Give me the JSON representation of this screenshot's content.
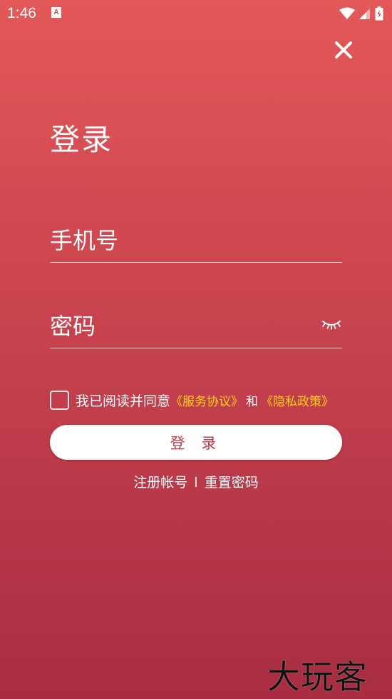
{
  "status_bar": {
    "time": "1:46",
    "app_icon_letter": "A"
  },
  "page": {
    "title": "登录"
  },
  "form": {
    "phone_placeholder": "手机号",
    "password_placeholder": "密码"
  },
  "agreement": {
    "prefix": "我已阅读并同意",
    "service_link": "《服务协议》",
    "and_text": "和",
    "privacy_link": "《隐私政策》"
  },
  "login_button_label": "登 录",
  "links": {
    "register": "注册帐号",
    "reset_password": "重置密码"
  },
  "watermark": "大玩客",
  "colors": {
    "gradient_top": "#e35858",
    "gradient_bottom": "#a82d42",
    "link_yellow": "#ffd21a",
    "button_text": "#c23c4c"
  }
}
